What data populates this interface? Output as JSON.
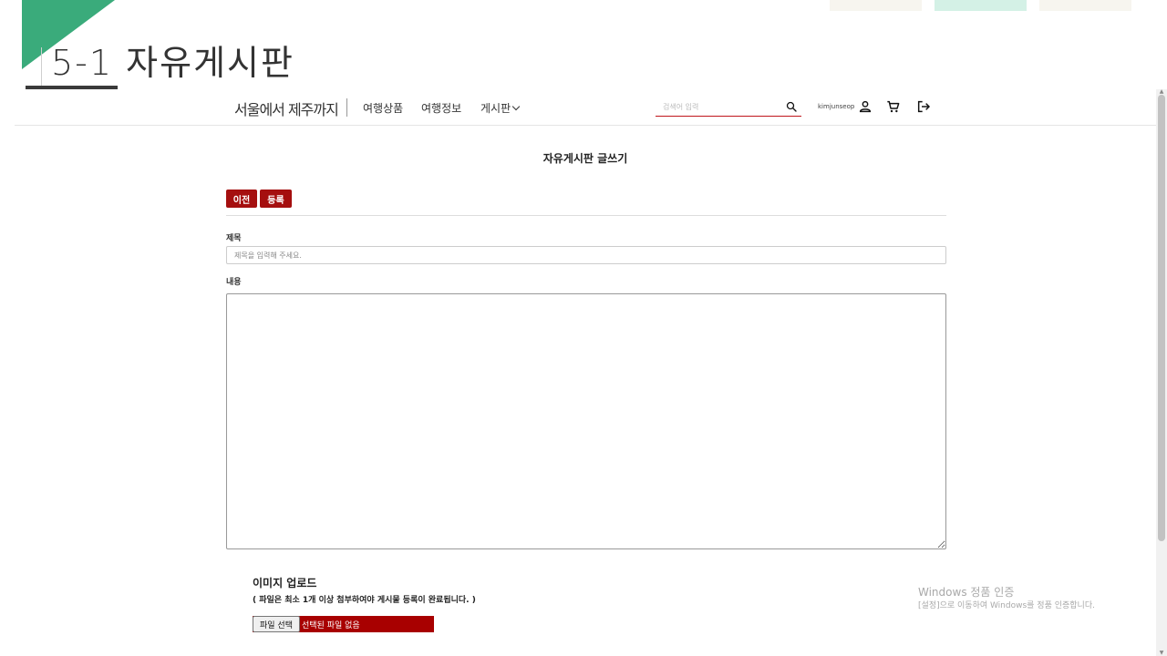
{
  "slide": {
    "title": "5-1  자유게시판",
    "accent_color": "#3aab7b"
  },
  "header": {
    "logo": "서울에서 제주까지",
    "nav": {
      "travel_products": "여행상품",
      "travel_info": "여행정보",
      "board": "게시판"
    },
    "search": {
      "placeholder": "검색어 입력",
      "value": ""
    },
    "username": "kimjunseop",
    "icons": [
      "search-icon",
      "user-icon",
      "cart-icon",
      "logout-icon"
    ]
  },
  "page": {
    "title": "자유게시판 글쓰기",
    "buttons": {
      "prev": "이전",
      "submit": "등록"
    },
    "form": {
      "title_label": "제목",
      "title_placeholder": "제목을 입력해 주세요.",
      "content_label": "내용"
    },
    "upload": {
      "title": "이미지 업로드",
      "note": "( 파일은 최소 1개 이상 첨부하여야 게시물 등록이 완료됩니다. )",
      "choose_button": "파일 선택",
      "status": "선택된 파일 없음"
    },
    "accent_color": "#a50f0f"
  },
  "watermark": {
    "line1": "Windows 정품 인증",
    "line2": "[설정]으로 이동하여 Windows를 정품 인증합니다."
  }
}
